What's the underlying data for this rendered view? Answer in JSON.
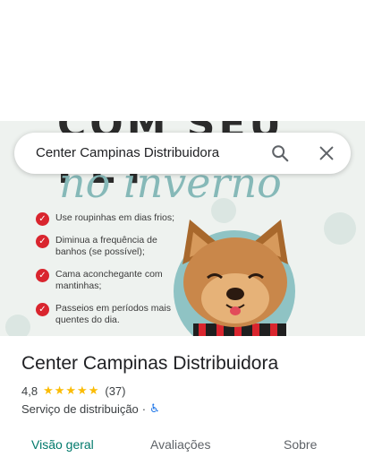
{
  "hero": {
    "heading_big": "COM SEU PET",
    "heading_script": "no inverno",
    "tips": [
      {
        "text": "Use roupinhas em dias frios;"
      },
      {
        "text": "Diminua a frequência de banhos (se possível);"
      },
      {
        "text": "Cama aconchegante com mantinhas;"
      },
      {
        "text": "Passeios em períodos mais quentes do dia."
      }
    ]
  },
  "search": {
    "value": "Center Campinas Distribuidora"
  },
  "place": {
    "name": "Center Campinas Distribuidora",
    "rating": "4,8",
    "stars": "★★★★★",
    "reviews": "(37)",
    "category": "Serviço de distribuição",
    "separator": "·"
  },
  "tabs": [
    {
      "label": "Visão geral",
      "active": true
    },
    {
      "label": "Avaliações",
      "active": false
    },
    {
      "label": "Sobre",
      "active": false
    }
  ],
  "colors": {
    "accent": "#00796b",
    "star": "#fbbc04",
    "check": "#d9252e"
  }
}
